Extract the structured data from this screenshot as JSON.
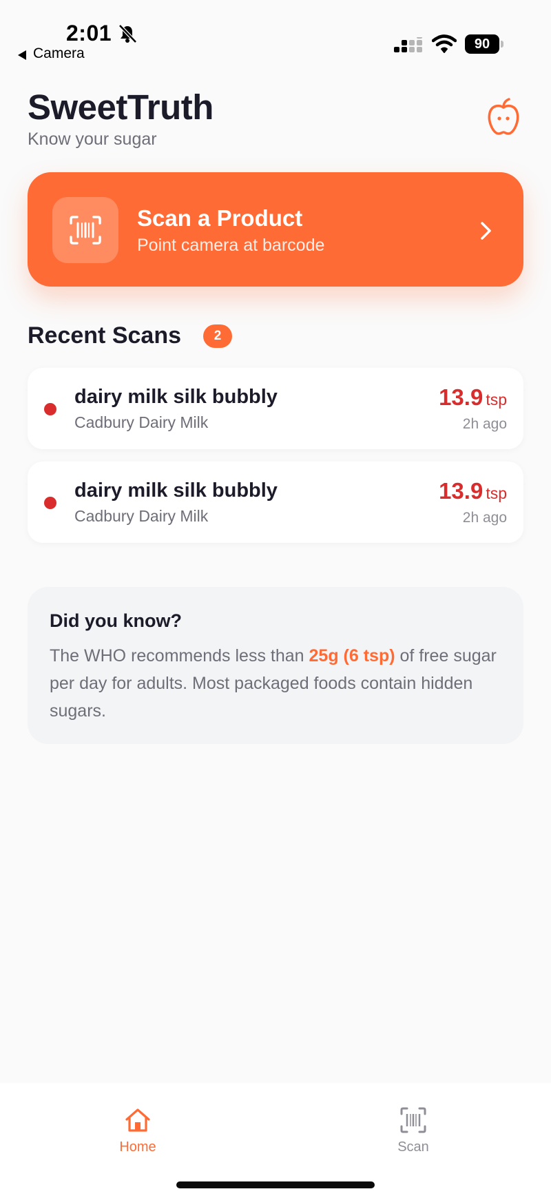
{
  "status_bar": {
    "time": "2:01",
    "back_label": "Camera",
    "battery": "90"
  },
  "header": {
    "title": "SweetTruth",
    "subtitle": "Know your sugar"
  },
  "scan_card": {
    "title": "Scan a Product",
    "subtitle": "Point camera at barcode"
  },
  "recent": {
    "title": "Recent Scans",
    "count": "2",
    "items": [
      {
        "name": "dairy milk silk bubbly",
        "brand": "Cadbury Dairy Milk",
        "amount": "13.9",
        "unit": "tsp",
        "time": "2h ago"
      },
      {
        "name": "dairy milk silk bubbly",
        "brand": "Cadbury Dairy Milk",
        "amount": "13.9",
        "unit": "tsp",
        "time": "2h ago"
      }
    ]
  },
  "info": {
    "title": "Did you know?",
    "body_before": "The WHO recommends less than ",
    "highlight": "25g (6 tsp)",
    "body_after": " of free sugar per day for adults. Most packaged foods contain hidden sugars."
  },
  "tabs": [
    {
      "label": "Home",
      "icon": "home-icon",
      "active": true
    },
    {
      "label": "Scan",
      "icon": "barcode-scan-icon",
      "active": false
    }
  ],
  "colors": {
    "accent": "#ff6b35",
    "danger": "#d92d2d",
    "text": "#1c1b29",
    "muted": "#6e6e78",
    "background": "#fafafa"
  }
}
